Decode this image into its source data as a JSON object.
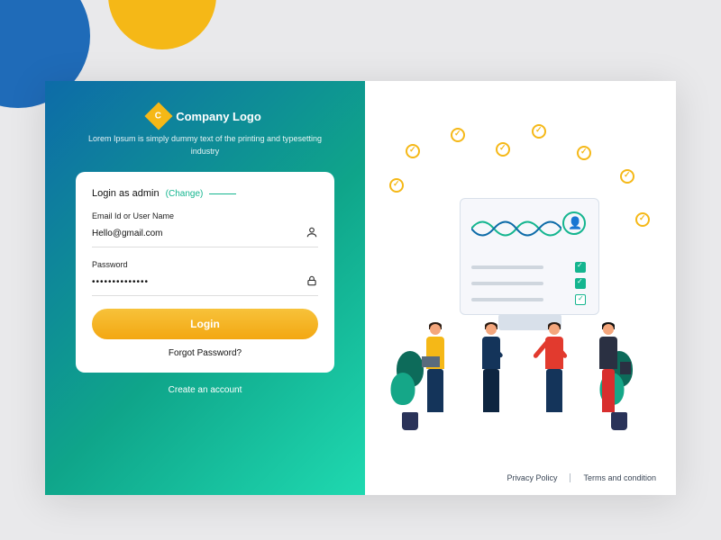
{
  "brand": {
    "logo_letter": "C",
    "name": "Company Logo",
    "tagline": "Lorem Ipsum is simply dummy text of the printing and typesetting industry"
  },
  "login": {
    "as_label": "Login as admin",
    "change_label": "(Change)",
    "email_label": "Email Id or User Name",
    "email_value": "Hello@gmail.com",
    "password_label": "Password",
    "password_value": "••••••••••••••",
    "submit_label": "Login",
    "forgot_label": "Forgot Password?",
    "create_label": "Create an account"
  },
  "footer": {
    "privacy": "Privacy Policy",
    "terms": "Terms and condition"
  },
  "colors": {
    "accent_yellow": "#f5b817",
    "accent_teal": "#14b58f",
    "panel_grad_start": "#0d6ba8",
    "panel_grad_end": "#1fd9b0"
  }
}
